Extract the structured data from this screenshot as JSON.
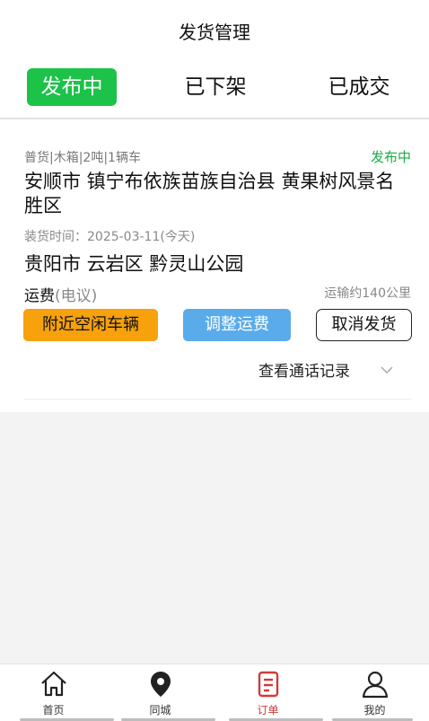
{
  "header": {
    "title": "发货管理"
  },
  "tabs": [
    {
      "label": "发布中",
      "active": true
    },
    {
      "label": "已下架",
      "active": false
    },
    {
      "label": "已成交",
      "active": false
    }
  ],
  "order": {
    "meta": "普货|木箱|2吨|1辆车",
    "status": "发布中",
    "from_address": "安顺市 镇宁布依族苗族自治县 黄果树风景名胜区",
    "load_time": "装货时间：2025-03-11(今天)",
    "to_address": "贵阳市 云岩区 黔灵山公园",
    "fee_label": "运费",
    "fee_value": "(电议)",
    "distance": "运输约140公里",
    "buttons": {
      "nearby": "附近空闲车辆",
      "adjust": "调整运费",
      "cancel": "取消发货"
    },
    "call_records": "查看通话记录"
  },
  "bottom_nav": [
    {
      "label": "首页",
      "icon": "home-icon"
    },
    {
      "label": "同城",
      "icon": "location-icon"
    },
    {
      "label": "订单",
      "icon": "order-icon",
      "active": true
    },
    {
      "label": "我的",
      "icon": "user-icon"
    }
  ],
  "colors": {
    "accent_green": "#1dc249",
    "status_green": "#1dab45",
    "orange_button": "#f7a10c",
    "blue_button": "#5aabea",
    "active_nav_red": "#d23a3a"
  }
}
